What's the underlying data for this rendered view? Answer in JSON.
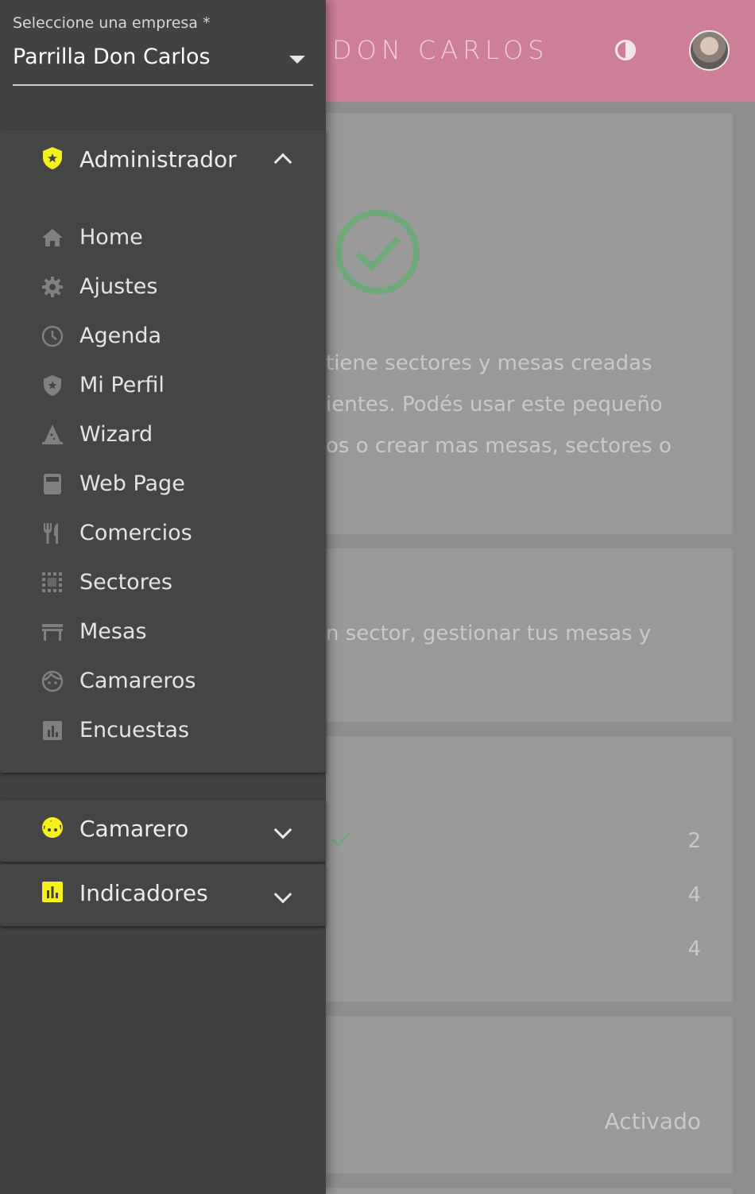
{
  "header": {
    "brand": "DON CARLOS",
    "contrast_icon": "invert-colors-icon",
    "avatar": "user-avatar"
  },
  "background": {
    "line1": "tiene sectores y mesas creadas",
    "line2": "ientes. Podés usar este pequeño",
    "line3": "os o crear mas mesas, sectores o",
    "line4": "n sector, gestionar tus mesas y",
    "stats": [
      "2",
      "4",
      "4"
    ],
    "status": "Activado"
  },
  "drawer": {
    "company_label": "Seleccione una empresa *",
    "company_value": "Parrilla Don Carlos",
    "admin": {
      "label": "Administrador",
      "icon": "shield-star-icon",
      "expanded": true,
      "items": [
        {
          "label": "Home",
          "icon": "home-icon"
        },
        {
          "label": "Ajustes",
          "icon": "gear-icon"
        },
        {
          "label": "Agenda",
          "icon": "clock-icon"
        },
        {
          "label": "Mi Perfil",
          "icon": "shield-icon"
        },
        {
          "label": "Wizard",
          "icon": "wizard-hat-icon"
        },
        {
          "label": "Web Page",
          "icon": "web-page-icon"
        },
        {
          "label": "Comercios",
          "icon": "restaurant-icon"
        },
        {
          "label": "Sectores",
          "icon": "grid-icon"
        },
        {
          "label": "Mesas",
          "icon": "table-icon"
        },
        {
          "label": "Camareros",
          "icon": "face-icon"
        },
        {
          "label": "Encuestas",
          "icon": "bar-chart-icon"
        }
      ]
    },
    "camarero": {
      "label": "Camarero",
      "icon": "face-icon",
      "expanded": false
    },
    "indicadores": {
      "label": "Indicadores",
      "icon": "bar-chart-icon",
      "expanded": false
    }
  },
  "colors": {
    "topbar": "#ce7f98",
    "drawer": "#424242",
    "accent_yellow": "#f6f01c",
    "success_green": "#6fa87b"
  }
}
